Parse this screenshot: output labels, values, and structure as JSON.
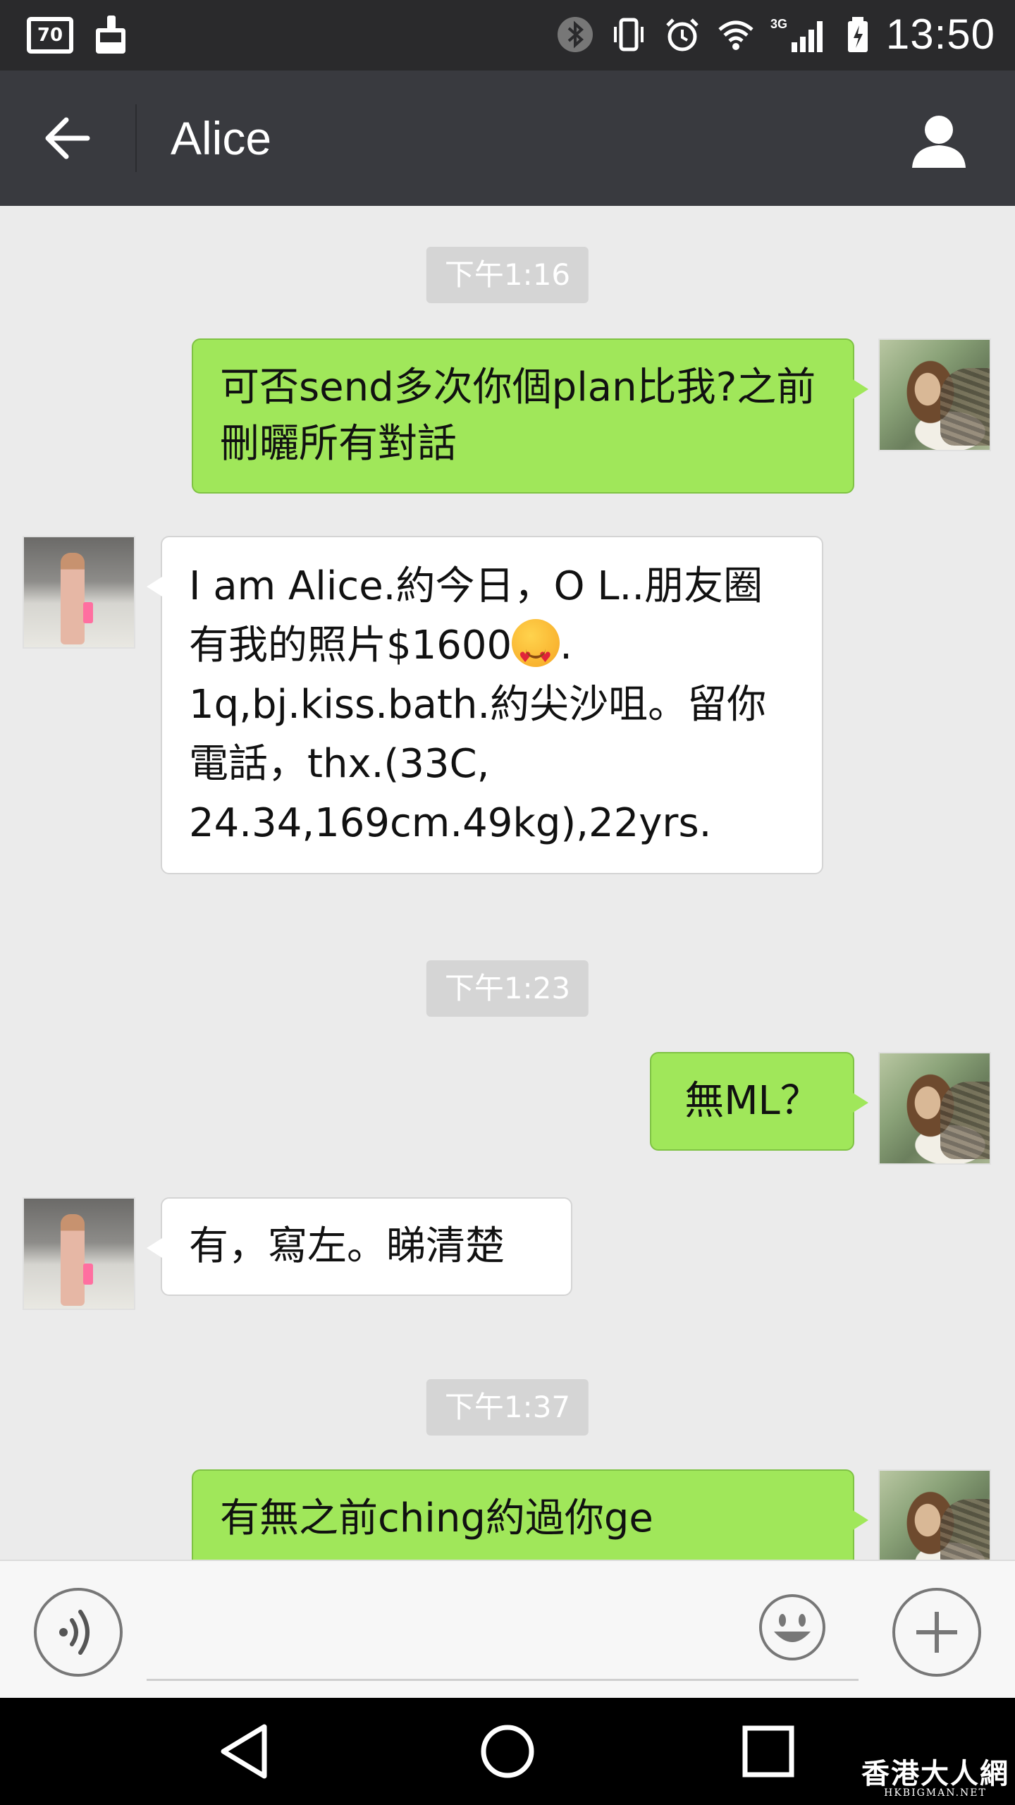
{
  "status_bar": {
    "battery_badge": "70",
    "network": "3G",
    "time": "13:50"
  },
  "header": {
    "title": "Alice"
  },
  "messages": [
    {
      "type": "time",
      "text": "下午1:16"
    },
    {
      "type": "out",
      "text": "可否send多次你個plan比我?之前刪曬所有對話"
    },
    {
      "type": "in",
      "text_a": "I am Alice.約今日，O L..朋友圈有我的照片$1600",
      "emoji": "heart-eyes-emoji",
      "text_b": ". 1q,bj.kiss.bath.約尖沙咀。留你電話，thx.(33C, 24.34,169cm.49kg),22yrs."
    },
    {
      "type": "time",
      "text": "下午1:23"
    },
    {
      "type": "out",
      "text": "無ML？"
    },
    {
      "type": "in",
      "text": "有，寫左。睇清楚"
    },
    {
      "type": "time",
      "text": "下午1:37"
    },
    {
      "type": "out",
      "text": "有無之前ching約過你ge"
    }
  ],
  "input": {
    "placeholder": ""
  },
  "watermark": {
    "main": "香港大人網",
    "sub": "HKBIGMAN.NET"
  },
  "colors": {
    "status_bar_bg": "#2a2a2c",
    "title_bar_bg": "#393a3f",
    "chat_bg": "#ebebeb",
    "bubble_out": "#a0e75a",
    "bubble_in": "#ffffff",
    "time_chip": "#d5d5d5"
  }
}
